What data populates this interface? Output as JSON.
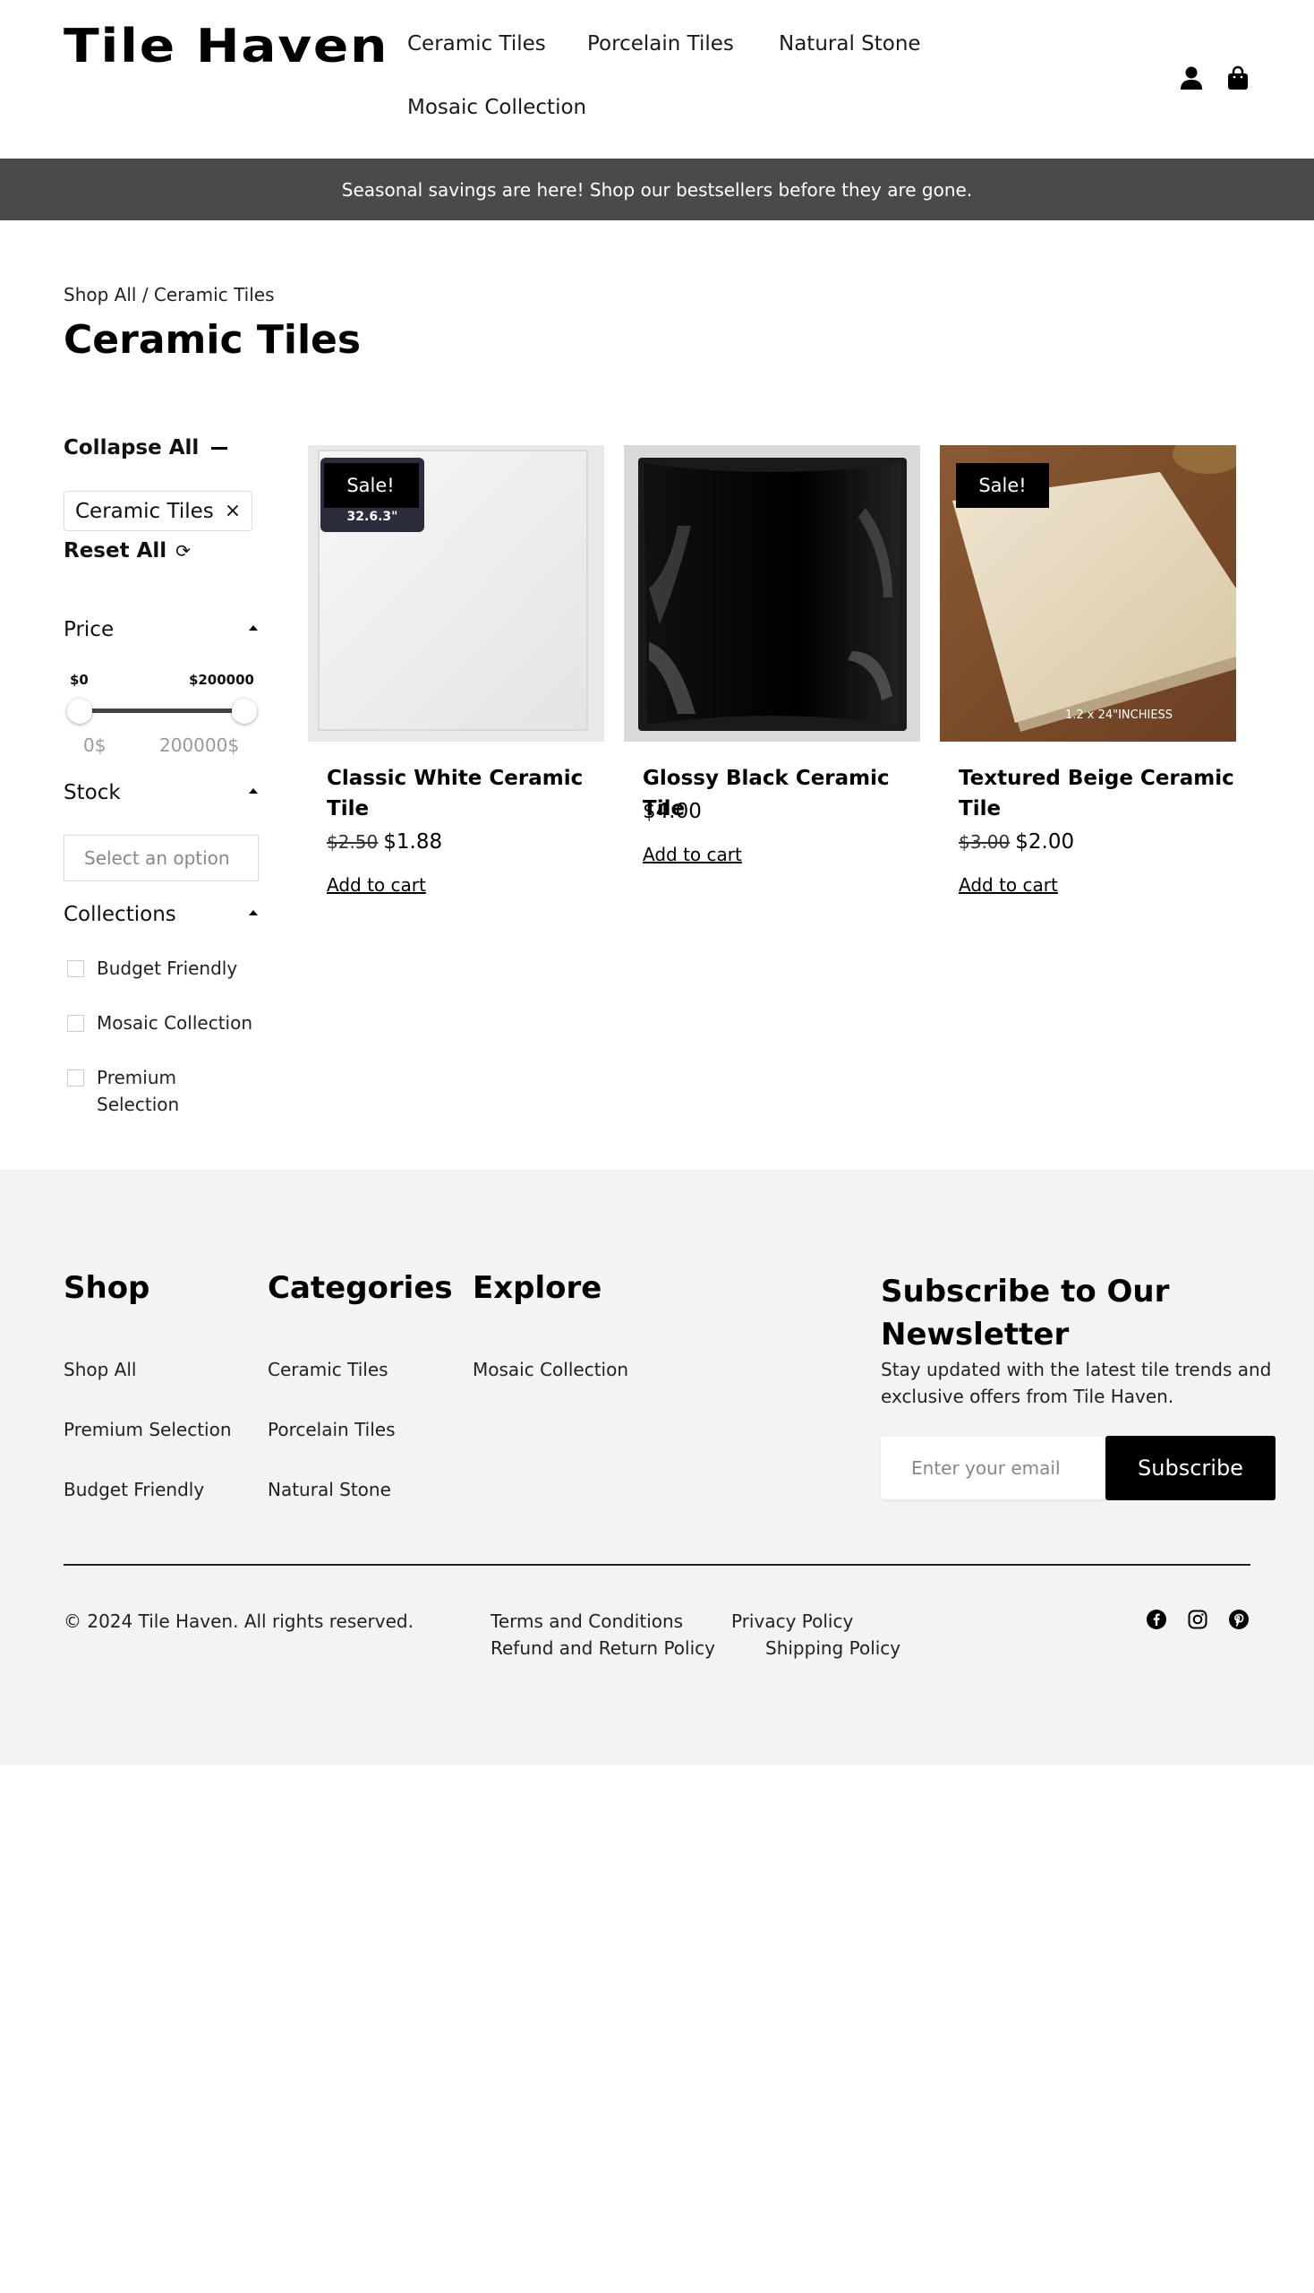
{
  "header": {
    "logo": "Tile Haven",
    "nav": [
      "Ceramic Tiles",
      "Porcelain Tiles",
      "Natural Stone",
      "Mosaic Collection"
    ],
    "icons": [
      "account-icon",
      "shopping-bag-icon"
    ]
  },
  "banner": {
    "text": "Seasonal savings are here! Shop our bestsellers before they are gone."
  },
  "breadcrumb": {
    "parent": "Shop All",
    "separator": " / ",
    "current": "Ceramic Tiles"
  },
  "page": {
    "title": "Ceramic Tiles"
  },
  "filters": {
    "collapse_all": "Collapse All",
    "active_chip": "Ceramic Tiles",
    "chip_close": "×",
    "reset_all": "Reset All",
    "price": {
      "title": "Price",
      "min_label": "$0",
      "max_label": "$200000",
      "min_input": "0$",
      "max_input": "200000$",
      "range": [
        0,
        200000
      ]
    },
    "stock": {
      "title": "Stock",
      "placeholder": "Select an option"
    },
    "collections": {
      "title": "Collections",
      "items": [
        "Budget Friendly",
        "Mosaic Collection",
        "Premium Selection"
      ]
    }
  },
  "products": [
    {
      "name": "Classic White Ceramic Tile",
      "old_price": "$2.50",
      "price": "$1.88",
      "badge": "Sale!",
      "add_to_cart": "Add to cart",
      "image_caption": "32.6.3\""
    },
    {
      "name": "Glossy Black Ceramic Tile",
      "old_price": "",
      "price": "$4.00",
      "badge": "",
      "add_to_cart": "Add to cart",
      "image_caption": ""
    },
    {
      "name": "Textured Beige Ceramic Tile",
      "old_price": "$3.00",
      "price": "$2.00",
      "badge": "Sale!",
      "add_to_cart": "Add to cart",
      "image_caption": "1.2 x 24\"INCHIESS"
    }
  ],
  "footer": {
    "columns": [
      {
        "title": "Shop",
        "links": [
          "Shop All",
          "Premium Selection",
          "Budget Friendly"
        ]
      },
      {
        "title": "Categories",
        "links": [
          "Ceramic Tiles",
          "Porcelain Tiles",
          "Natural Stone"
        ]
      },
      {
        "title": "Explore",
        "links": [
          "Mosaic Collection"
        ]
      }
    ],
    "newsletter": {
      "title": "Subscribe to Our Newsletter",
      "text": "Stay updated with the latest tile trends and exclusive offers from Tile Haven.",
      "placeholder": "Enter your email",
      "button": "Subscribe"
    },
    "copyright": "© 2024 Tile Haven. All rights reserved.",
    "legal": [
      "Terms and Conditions",
      "Privacy Policy",
      "Refund and Return Policy",
      "Shipping Policy"
    ],
    "social": [
      "facebook-icon",
      "instagram-icon",
      "pinterest-icon"
    ]
  },
  "colors": {
    "banner_bg": "#4a4a4a",
    "footer_bg": "#f2f3f5",
    "button_bg": "#000000",
    "text": "#111111"
  }
}
